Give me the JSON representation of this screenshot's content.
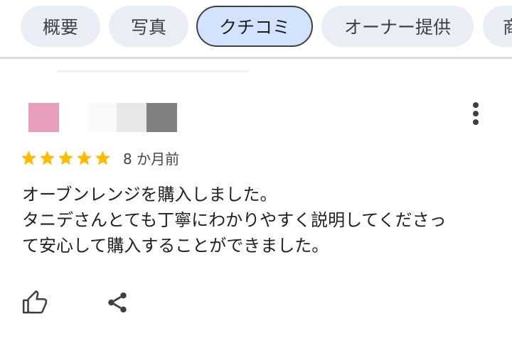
{
  "tabs": [
    {
      "label": "概要"
    },
    {
      "label": "写真"
    },
    {
      "label": "クチコミ",
      "active": true
    },
    {
      "label": "オーナー提供"
    },
    {
      "label": "商"
    }
  ],
  "review": {
    "author_avatar_color": "#e89dbd",
    "rating": 5,
    "rating_max": 5,
    "star_color": "#fbbc04",
    "date": "8 か月前",
    "text_lines": [
      "オーブンレンジを購入しました。",
      "タニデさんとても丁寧にわかりやすく説明してくださっ",
      "て安心して購入することができました。"
    ]
  },
  "icons": {
    "more": "more-vert-icon",
    "like": "thumb-up-icon",
    "share": "share-icon"
  }
}
